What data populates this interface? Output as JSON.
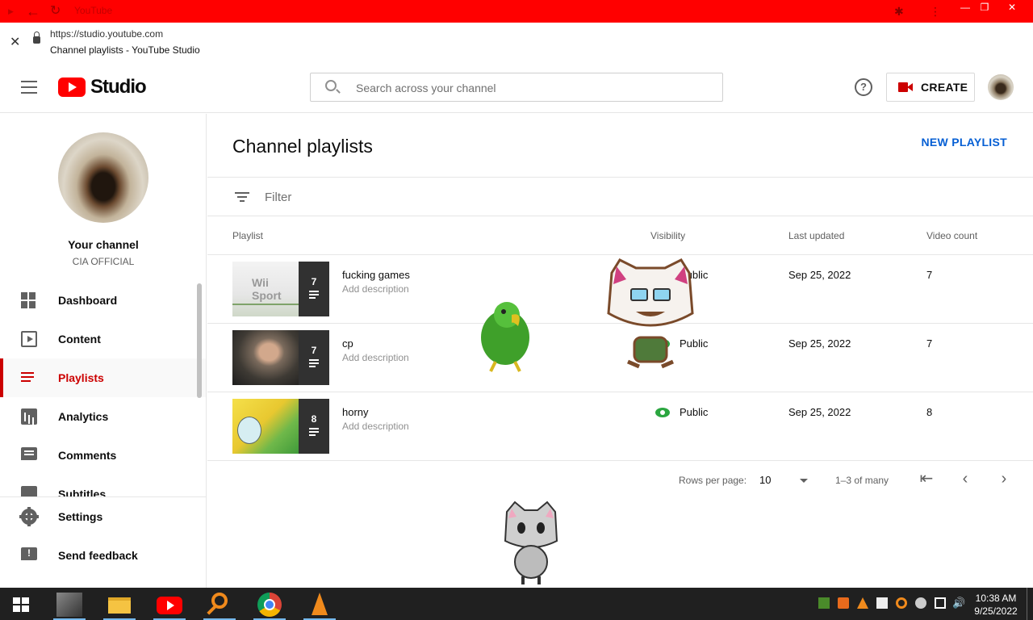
{
  "browser": {
    "title": "YouTube",
    "url": "https://studio.youtube.com",
    "page_title": "Channel playlists - YouTube Studio"
  },
  "header": {
    "logo_text": "Studio",
    "search_placeholder": "Search across your channel",
    "help_glyph": "?",
    "create_label": "CREATE"
  },
  "sidebar": {
    "channel_label": "Your channel",
    "channel_name": "CIA OFFICIAL",
    "items": [
      {
        "label": "Dashboard",
        "icon": "dashboard-icon"
      },
      {
        "label": "Content",
        "icon": "content-icon"
      },
      {
        "label": "Playlists",
        "icon": "playlists-icon",
        "active": true
      },
      {
        "label": "Analytics",
        "icon": "analytics-icon"
      },
      {
        "label": "Comments",
        "icon": "comments-icon"
      },
      {
        "label": "Subtitles",
        "icon": "subtitles-icon"
      }
    ],
    "bottom_items": [
      {
        "label": "Settings",
        "icon": "settings-icon"
      },
      {
        "label": "Send feedback",
        "icon": "feedback-icon"
      }
    ]
  },
  "main": {
    "title": "Channel playlists",
    "new_playlist_label": "NEW PLAYLIST",
    "filter_placeholder": "Filter",
    "columns": [
      "Playlist",
      "Visibility",
      "Last updated",
      "Video count"
    ],
    "rows": [
      {
        "name": "fucking games",
        "description": "Add description",
        "thumb_count": "7",
        "visibility": "Public",
        "last_updated": "Sep 25, 2022",
        "video_count": "7"
      },
      {
        "name": "cp",
        "description": "Add description",
        "thumb_count": "7",
        "visibility": "Public",
        "last_updated": "Sep 25, 2022",
        "video_count": "7"
      },
      {
        "name": "horny",
        "description": "Add description",
        "thumb_count": "8",
        "visibility": "Public",
        "last_updated": "Sep 25, 2022",
        "video_count": "8"
      }
    ],
    "thumb_text_row1": "Wii Sport",
    "pagination": {
      "rows_per_page_label": "Rows per page:",
      "rows_per_page_value": "10",
      "range": "1–3 of many"
    }
  },
  "taskbar": {
    "time": "10:38 AM",
    "date": "9/25/2022"
  },
  "colors": {
    "brand_red": "#ff0000",
    "active_red": "#cc0000",
    "link_blue": "#065fd4",
    "public_green": "#2ba640"
  }
}
